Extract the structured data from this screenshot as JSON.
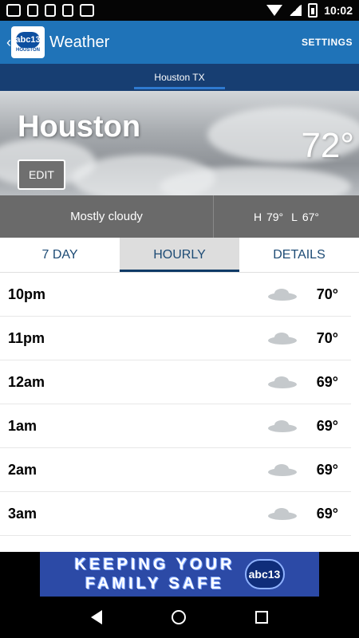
{
  "status_bar": {
    "time": "10:02",
    "icons_left": [
      "voicemail-icon",
      "notification-icon",
      "tools-icon",
      "lock-icon",
      "android-icon"
    ],
    "icons_right": [
      "wifi-icon",
      "signal-icon",
      "battery-charging-icon"
    ]
  },
  "app_bar": {
    "title": "Weather",
    "settings_label": "SETTINGS",
    "logo_text": "abc13",
    "logo_caption": "HOUSTON"
  },
  "location_bar": {
    "label": "Houston TX"
  },
  "hero": {
    "city": "Houston",
    "temperature": "72°",
    "edit_label": "EDIT"
  },
  "summary": {
    "condition": "Mostly cloudy",
    "high_label": "H",
    "high": "79°",
    "low_label": "L",
    "low": "67°"
  },
  "tabs": [
    {
      "label": "7 DAY",
      "active": false
    },
    {
      "label": "HOURLY",
      "active": true
    },
    {
      "label": "DETAILS",
      "active": false
    }
  ],
  "hourly": [
    {
      "time": "10pm",
      "icon": "cloudy-icon",
      "temp": "70°"
    },
    {
      "time": "11pm",
      "icon": "cloudy-icon",
      "temp": "70°"
    },
    {
      "time": "12am",
      "icon": "cloudy-icon",
      "temp": "69°"
    },
    {
      "time": "1am",
      "icon": "cloudy-icon",
      "temp": "69°"
    },
    {
      "time": "2am",
      "icon": "cloudy-icon",
      "temp": "69°"
    },
    {
      "time": "3am",
      "icon": "cloudy-icon",
      "temp": "69°"
    }
  ],
  "ad": {
    "line1": "KEEPING YOUR",
    "line2": "FAMILY SAFE",
    "logo_text": "abc13"
  },
  "colors": {
    "app_bar": "#1f73b8",
    "location_bar": "#173e72",
    "summary_bg": "#6a6a6a",
    "tab_text": "#1d4b75",
    "ad_bg": "#2c4aa6"
  }
}
